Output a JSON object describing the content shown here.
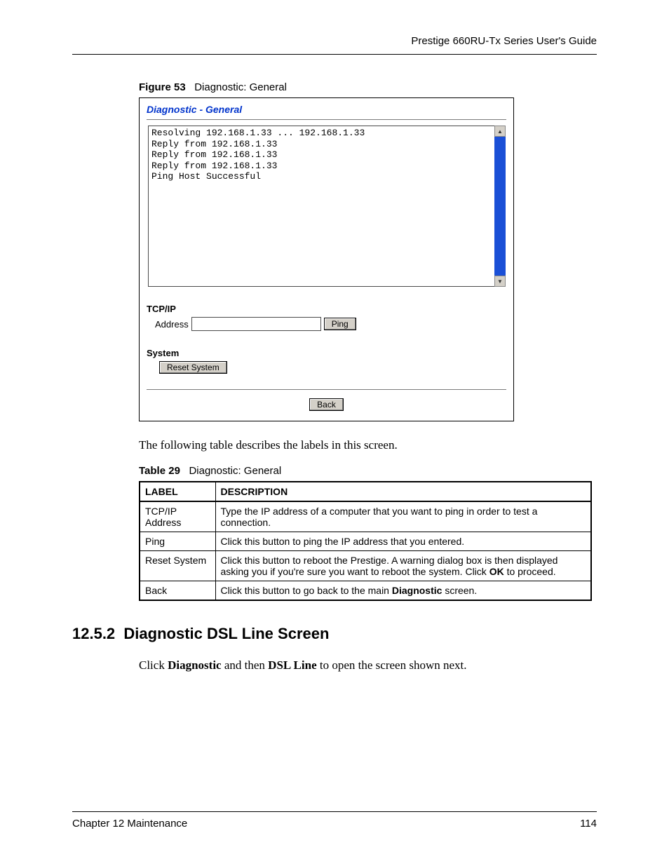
{
  "header": {
    "guide_title": "Prestige 660RU-Tx Series User's Guide"
  },
  "figure": {
    "label": "Figure 53",
    "title": "Diagnostic: General",
    "panel_title": "Diagnostic - General",
    "console_output": "Resolving 192.168.1.33 ... 192.168.1.33\nReply from 192.168.1.33\nReply from 192.168.1.33\nReply from 192.168.1.33\nPing Host Successful",
    "section_tcpip": "TCP/IP",
    "address_label": "Address",
    "address_value": "",
    "ping_button": "Ping",
    "section_system": "System",
    "reset_button": "Reset System",
    "back_button": "Back"
  },
  "intro_text": "The following table describes the labels in this screen.",
  "table": {
    "label": "Table 29",
    "title": "Diagnostic: General",
    "head_label": "LABEL",
    "head_desc": "DESCRIPTION",
    "rows": [
      {
        "label": "TCP/IP Address",
        "desc_plain": "Type the IP address of a computer that you want to ping in order to test a connection."
      },
      {
        "label": "Ping",
        "desc_plain": "Click this button to ping the IP address that you entered."
      },
      {
        "label": "Reset System",
        "desc_pre": "Click this button to reboot the Prestige. A warning dialog box is then displayed asking you if you're sure you want to reboot the system. Click ",
        "desc_bold": "OK",
        "desc_post": " to proceed."
      },
      {
        "label": "Back",
        "desc_pre": "Click this button to go back to the main ",
        "desc_bold": "Diagnostic",
        "desc_post": " screen."
      }
    ]
  },
  "section": {
    "number": "12.5.2",
    "title": "Diagnostic DSL Line Screen",
    "body_pre": "Click ",
    "body_b1": "Diagnostic",
    "body_mid": " and then ",
    "body_b2": "DSL Line",
    "body_post": " to open the screen shown next."
  },
  "footer": {
    "chapter": "Chapter 12 Maintenance",
    "page": "114"
  }
}
